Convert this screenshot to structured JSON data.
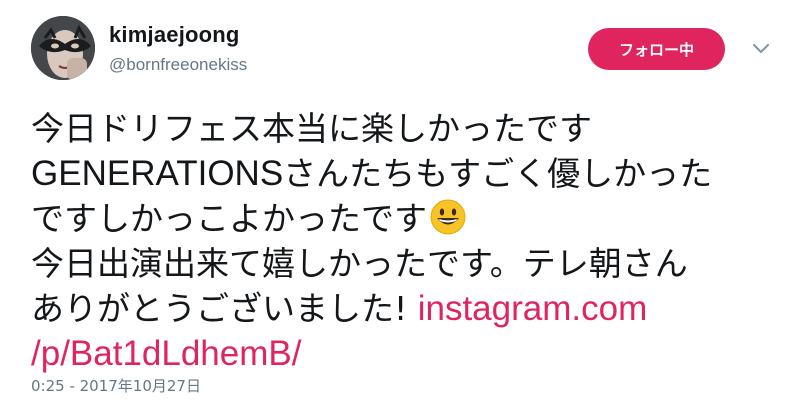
{
  "user": {
    "display_name": "kimjaejoong",
    "handle": "@bornfreeonekiss",
    "avatar_icon": "masked-face-avatar"
  },
  "follow_button": {
    "label": "フォロー中",
    "color": "#e0245e"
  },
  "menu_icon": "chevron-down-icon",
  "tweet": {
    "line1": "今日ドリフェス本当に楽しかったです",
    "line2_latin": "GENERATIONS",
    "line2_rest": "さんたちもすごく優しかった",
    "line3": "ですしかっこよかったです",
    "line3_emoji": "grinning-face-emoji",
    "line4": "今日出演出来て嬉しかったです。テレ朝さん",
    "line5": "ありがとうございました! ",
    "link_part1": "instagram.com",
    "link_part2": "/p/Bat1dLdhemB/",
    "link_color": "#e0245e"
  },
  "timestamp": "0:25 - 2017年10月27日"
}
